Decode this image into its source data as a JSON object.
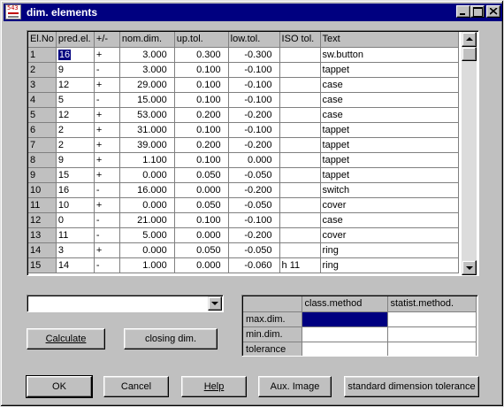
{
  "window": {
    "title": "dim. elements",
    "icon_label": "543",
    "controls": [
      "minimize",
      "maximize",
      "close"
    ]
  },
  "grid": {
    "columns": [
      "El.No",
      "pred.el.",
      "+/-",
      "nom.dim.",
      "up.tol.",
      "low.tol.",
      "ISO tol.",
      "Text"
    ],
    "rows": [
      [
        "1",
        "16",
        "+",
        "3.000",
        "0.300",
        "-0.300",
        "",
        "sw.button"
      ],
      [
        "2",
        "9",
        "-",
        "3.000",
        "0.100",
        "-0.100",
        "",
        "tappet"
      ],
      [
        "3",
        "12",
        "+",
        "29.000",
        "0.100",
        "-0.100",
        "",
        "case"
      ],
      [
        "4",
        "5",
        "-",
        "15.000",
        "0.100",
        "-0.100",
        "",
        "case"
      ],
      [
        "5",
        "12",
        "+",
        "53.000",
        "0.200",
        "-0.200",
        "",
        "case"
      ],
      [
        "6",
        "2",
        "+",
        "31.000",
        "0.100",
        "-0.100",
        "",
        "tappet"
      ],
      [
        "7",
        "2",
        "+",
        "39.000",
        "0.200",
        "-0.200",
        "",
        "tappet"
      ],
      [
        "8",
        "9",
        "+",
        "1.100",
        "0.100",
        "0.000",
        "",
        "tappet"
      ],
      [
        "9",
        "15",
        "+",
        "0.000",
        "0.050",
        "-0.050",
        "",
        "tappet"
      ],
      [
        "10",
        "16",
        "-",
        "16.000",
        "0.000",
        "-0.200",
        "",
        "switch"
      ],
      [
        "11",
        "10",
        "+",
        "0.000",
        "0.050",
        "-0.050",
        "",
        "cover"
      ],
      [
        "12",
        "0",
        "-",
        "21.000",
        "0.100",
        "-0.100",
        "",
        "case"
      ],
      [
        "13",
        "11",
        "-",
        "5.000",
        "0.000",
        "-0.200",
        "",
        "cover"
      ],
      [
        "14",
        "3",
        "+",
        "0.000",
        "0.050",
        "-0.050",
        "",
        "ring"
      ],
      [
        "15",
        "14",
        "-",
        "1.000",
        "0.000",
        "-0.060",
        "h 11",
        "ring"
      ]
    ],
    "selected_cell": "16"
  },
  "combo": {
    "value": ""
  },
  "buttons": {
    "calculate": "Calculate",
    "closing_dim": "closing dim.",
    "ok": "OK",
    "cancel": "Cancel",
    "help": "Help",
    "aux_image": "Aux. Image",
    "std_tol": "standard dimension tolerance"
  },
  "results": {
    "columns": [
      "class.method",
      "statist.method."
    ],
    "rows": [
      {
        "label": "max.dim.",
        "class": "",
        "statist": ""
      },
      {
        "label": "min.dim.",
        "class": "",
        "statist": ""
      },
      {
        "label": "tolerance",
        "class": "",
        "statist": ""
      }
    ]
  },
  "colors": {
    "selection": "#000080",
    "face": "#c0c0c0",
    "titlebar": "#000080"
  }
}
